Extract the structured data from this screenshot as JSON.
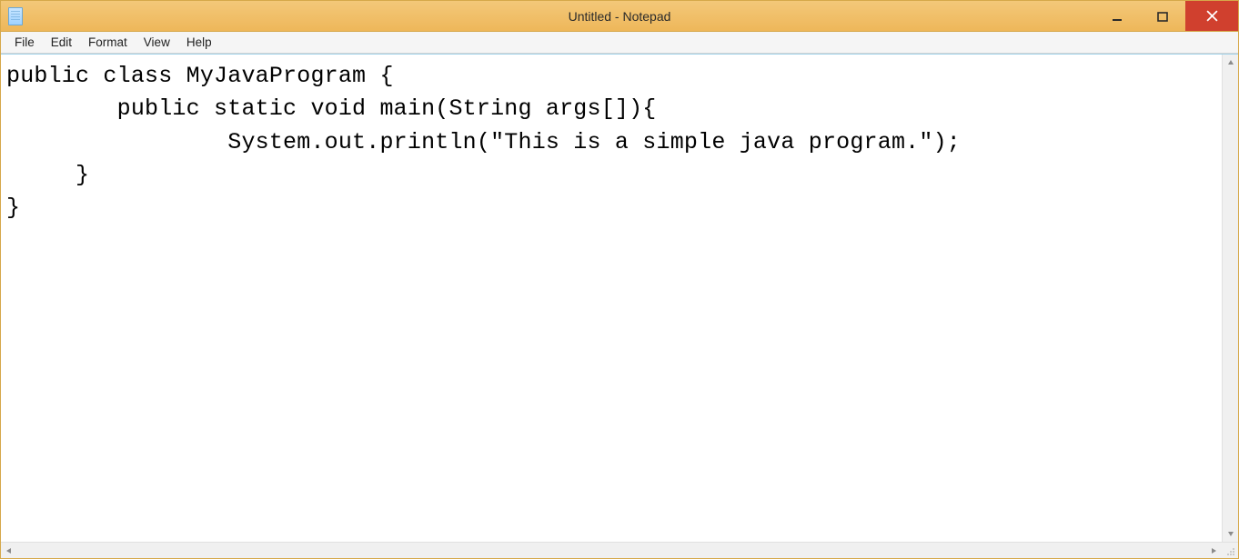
{
  "window": {
    "title": "Untitled - Notepad"
  },
  "menu": {
    "items": [
      "File",
      "Edit",
      "Format",
      "View",
      "Help"
    ]
  },
  "editor": {
    "content": "public class MyJavaProgram {\n        public static void main(String args[]){\n                System.out.println(\"This is a simple java program.\");\n     }\n}\n"
  }
}
